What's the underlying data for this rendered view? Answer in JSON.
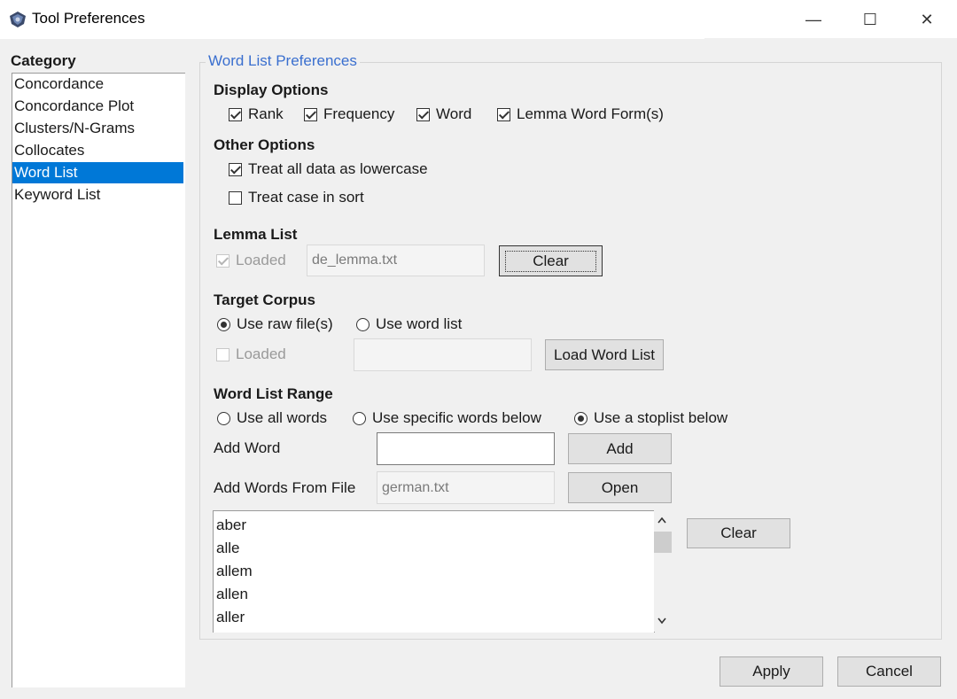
{
  "window": {
    "title": "Tool Preferences",
    "minimize_glyph": "—",
    "maximize_glyph": "☐",
    "close_glyph": "✕"
  },
  "sidebar": {
    "header": "Category",
    "items": [
      {
        "label": "Concordance"
      },
      {
        "label": "Concordance Plot"
      },
      {
        "label": "Clusters/N-Grams"
      },
      {
        "label": "Collocates"
      },
      {
        "label": "Word List",
        "selected": true
      },
      {
        "label": "Keyword List"
      }
    ]
  },
  "panel": {
    "legend": "Word List Preferences",
    "display_options": {
      "title": "Display Options",
      "rank": "Rank",
      "frequency": "Frequency",
      "word": "Word",
      "lemma_form": "Lemma Word Form(s)"
    },
    "other_options": {
      "title": "Other Options",
      "lowercase": "Treat all data as lowercase",
      "case_sort": "Treat case in sort"
    },
    "lemma_list": {
      "title": "Lemma List",
      "loaded_label": "Loaded",
      "file_value": "de_lemma.txt",
      "clear_label": "Clear"
    },
    "target_corpus": {
      "title": "Target Corpus",
      "raw_files": "Use raw file(s)",
      "word_list": "Use word list",
      "loaded_label": "Loaded",
      "file_value": "",
      "load_button": "Load Word List"
    },
    "word_list_range": {
      "title": "Word List Range",
      "all_words": "Use all words",
      "specific_words": "Use specific words below",
      "stoplist": "Use a stoplist below",
      "add_word_label": "Add Word",
      "add_word_value": "",
      "add_button": "Add",
      "add_file_label": "Add Words From File",
      "file_value": "german.txt",
      "open_button": "Open",
      "clear_button": "Clear",
      "list_items": [
        "aber",
        "alle",
        "allem",
        "allen",
        "aller"
      ]
    }
  },
  "footer": {
    "apply": "Apply",
    "cancel": "Cancel"
  },
  "colors": {
    "accent": "#0078d7",
    "legend": "#3a6fcf"
  }
}
